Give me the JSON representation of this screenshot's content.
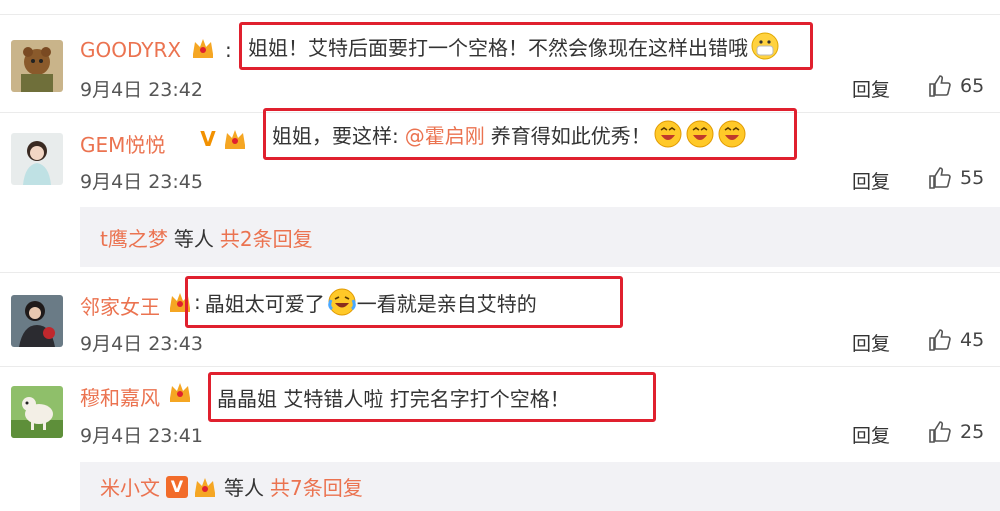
{
  "comments": [
    {
      "username": "GOODYRX",
      "text": "姐姐！艾特后面要打一个空格！不然会像现在这样出错哦",
      "time": "9月4日 23:42",
      "reply_label": "回复",
      "likes": "65"
    },
    {
      "username": "GEM悦悦",
      "text_before": "姐姐，要这样:",
      "mention": "@霍启刚",
      "text_after": "养育得如此优秀！",
      "time": "9月4日 23:45",
      "reply_label": "回复",
      "likes": "55"
    },
    {
      "username": "邻家女王",
      "text_before": "晶姐太可爱了",
      "text_after": "一看就是亲自艾特的",
      "time": "9月4日 23:43",
      "reply_label": "回复",
      "likes": "45"
    },
    {
      "username": "穆和嘉风",
      "text": "晶晶姐 艾特错人啦 打完名字打个空格！",
      "time": "9月4日 23:41",
      "reply_label": "回复",
      "likes": "25"
    }
  ],
  "sub_replies": [
    {
      "name": "t鹰之梦",
      "mid": "等人",
      "count": "共2条回复"
    },
    {
      "name": "米小文",
      "mid": "等人",
      "count": "共7条回复"
    }
  ],
  "colors": {
    "accent": "#eb7350",
    "highlight_border": "#e0202e",
    "subbar_bg": "#f2f2f5"
  },
  "icons": [
    "crown-badge-icon",
    "v-badge-icon",
    "thumbs-up-icon",
    "mask-emoji-icon",
    "grin-emoji-icon",
    "laugh-cry-emoji-icon"
  ]
}
